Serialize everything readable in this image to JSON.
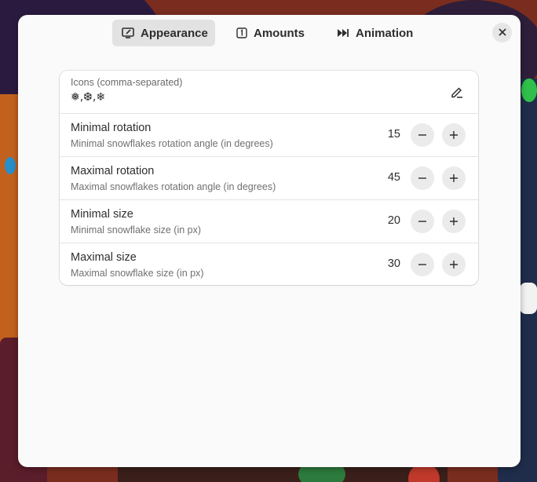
{
  "tabs": [
    {
      "label": "Appearance",
      "icon": "appearance-icon",
      "selected": true
    },
    {
      "label": "Amounts",
      "icon": "amounts-icon",
      "selected": false
    },
    {
      "label": "Animation",
      "icon": "animation-icon",
      "selected": false
    }
  ],
  "icons_entry": {
    "label": "Icons (comma-separated)",
    "value": "❅,❆,❄"
  },
  "rows": [
    {
      "title": "Minimal rotation",
      "subtitle": "Minimal snowflakes rotation angle (in degrees)",
      "value": "15"
    },
    {
      "title": "Maximal rotation",
      "subtitle": "Maximal snowflakes rotation angle (in degrees)",
      "value": "45"
    },
    {
      "title": "Minimal size",
      "subtitle": "Minimal snowflake size (in px)",
      "value": "20"
    },
    {
      "title": "Maximal size",
      "subtitle": "Maximal snowflake size (in px)",
      "value": "30"
    }
  ],
  "colors": {
    "dialog_bg": "#fafafa",
    "selected_tab_bg": "#e2e2e2",
    "text": "#2e2e2e"
  }
}
